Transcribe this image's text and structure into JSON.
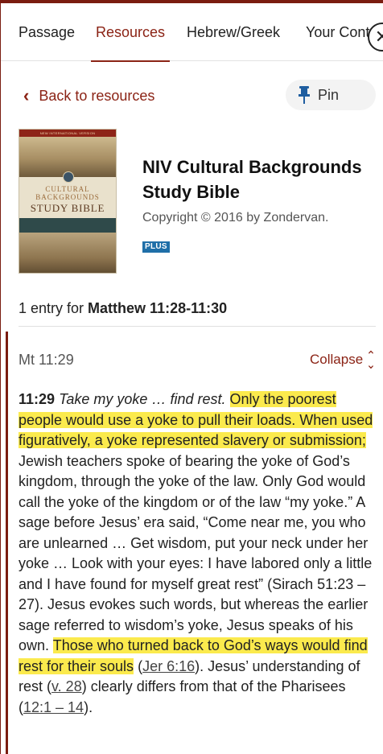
{
  "tabs": [
    {
      "label": "Passage",
      "active": false
    },
    {
      "label": "Resources",
      "active": true
    },
    {
      "label": "Hebrew/Greek",
      "active": false
    },
    {
      "label": "Your Cont",
      "active": false
    }
  ],
  "header": {
    "back_label": "Back to resources",
    "pin_label": "Pin"
  },
  "book": {
    "cover_band": "NEW INTERNATIONAL VERSION",
    "cover_line1": "CULTURAL",
    "cover_line2": "BACKGROUNDS",
    "cover_line3": "STUDY BIBLE",
    "title": "NIV Cultural Backgrounds Study Bible",
    "copyright": "Copyright © 2016 by Zondervan.",
    "badge": "PLUS"
  },
  "entries": {
    "count_prefix": "1 entry for ",
    "passage": "Matthew 11:28-11:30"
  },
  "note": {
    "reference": "Mt 11:29",
    "collapse_label": "Collapse",
    "verse_num": "11:29",
    "verse_quote": "Take my yoke … find rest.",
    "hl1": "Only the poorest people would use a yoke to pull their loads. When used figuratively, a yoke represented slavery or submission;",
    "text1": " Jewish teachers spoke of bearing the yoke of God’s kingdom, through the yoke of the law. Only God would call the yoke of the kingdom or of the law “my yoke.” A sage before Jesus’ era said, “Come near me, you who are unlearned … Get wisdom, put your neck under her yoke … Look with your eyes: I have labored only a little and I have found for myself great rest” (Sirach 51:23 – 27). Jesus evokes such words, but whereas the earlier sage referred to wisdom’s yoke, Jesus speaks of his own. ",
    "hl2": "Those who turned back to God’s ways would find rest for their souls",
    "text2": " (",
    "link1": "Jer 6:16",
    "text3": "). Jesus’ understanding of rest (",
    "link2": "v. 28",
    "text4": ") clearly differs from that of the Pharisees (",
    "link3": "12:1 – 14",
    "text5": ")."
  },
  "colors": {
    "accent": "#8b2315",
    "highlight": "#fbea4d",
    "badge": "#1f6fa8"
  },
  "icons": [
    "close-icon",
    "chevron-left-icon",
    "pin-icon",
    "collapse-icon"
  ]
}
